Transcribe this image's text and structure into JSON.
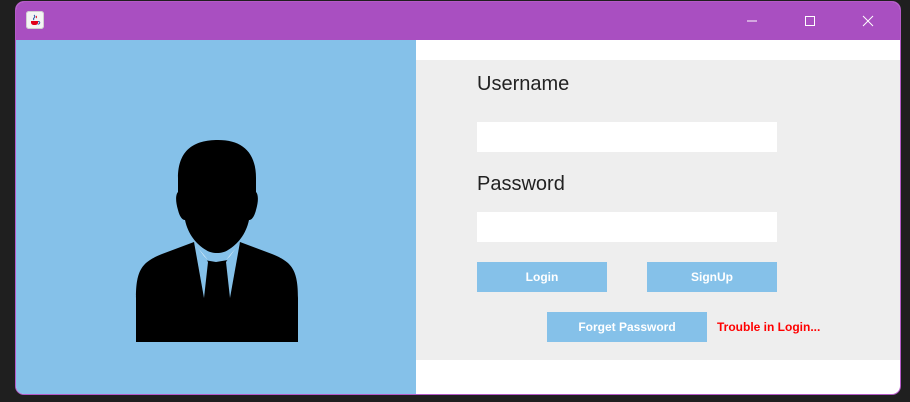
{
  "window": {
    "app_icon": "java-cup-icon",
    "controls": {
      "minimize_icon": "minimize-icon",
      "maximize_icon": "maximize-icon",
      "close_icon": "close-icon"
    }
  },
  "left_panel": {
    "avatar_icon": "businessman-user-icon"
  },
  "form": {
    "username_label": "Username",
    "username_value": "",
    "password_label": "Password",
    "password_value": "",
    "login_label": "Login",
    "signup_label": "SignUp",
    "forget_label": "Forget Password",
    "trouble_label": "Trouble in Login..."
  },
  "colors": {
    "titlebar": "#a94fc1",
    "panel_blue": "#85c1e9",
    "form_background": "#eeeeee",
    "link_red": "#ff0000"
  }
}
